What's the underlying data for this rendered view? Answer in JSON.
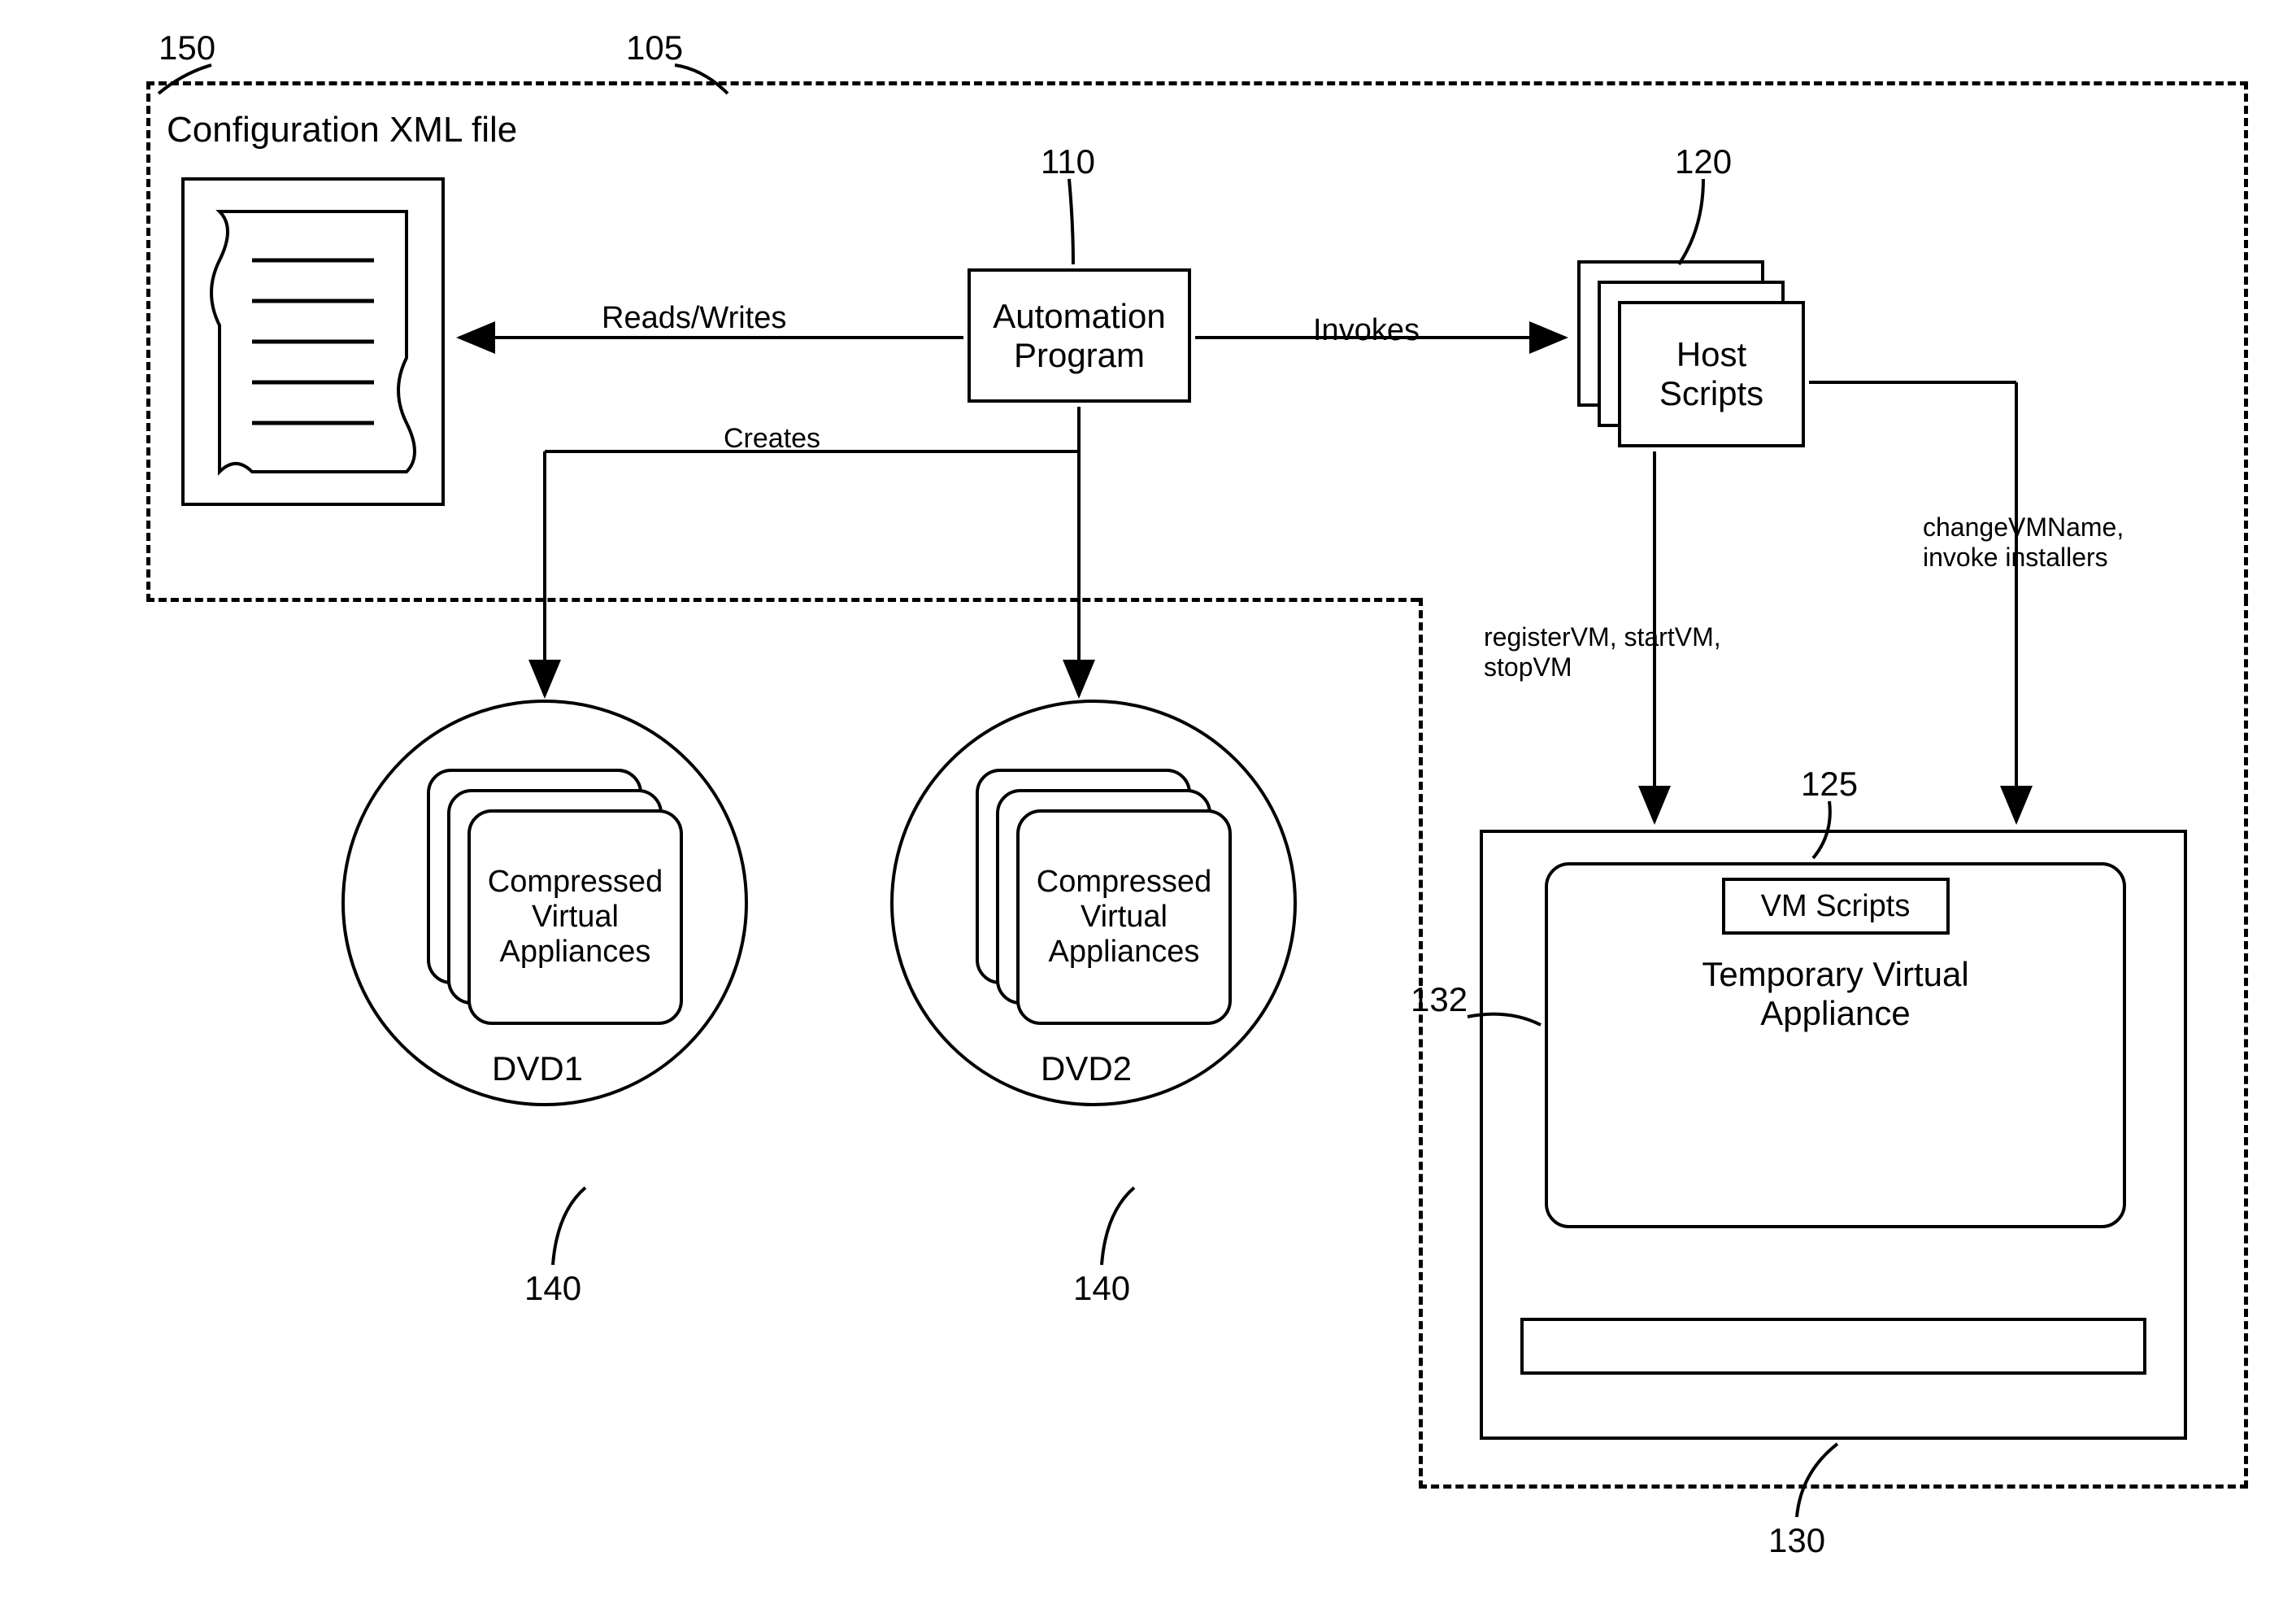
{
  "refs": {
    "config_file": "150",
    "host_system": "105",
    "automation_program": "110",
    "host_scripts": "120",
    "vm_scripts": "125",
    "vm_system": "130",
    "temp_va": "132",
    "dvd1": "140",
    "dvd2": "140"
  },
  "nodes": {
    "config_title": "Configuration XML file",
    "automation_program": "Automation\nProgram",
    "host_scripts": "Host\nScripts",
    "vm_scripts": "VM Scripts",
    "temp_va": "Temporary Virtual\nAppliance",
    "compressed_va": "Compressed\nVirtual\nAppliances",
    "dvd1": "DVD1",
    "dvd2": "DVD2"
  },
  "edges": {
    "reads_writes": "Reads/Writes",
    "invokes": "Invokes",
    "creates": "Creates",
    "left_script_edge": "registerVM, startVM,\nstopVM",
    "right_script_edge": "changeVMName,\ninvoke installers"
  }
}
